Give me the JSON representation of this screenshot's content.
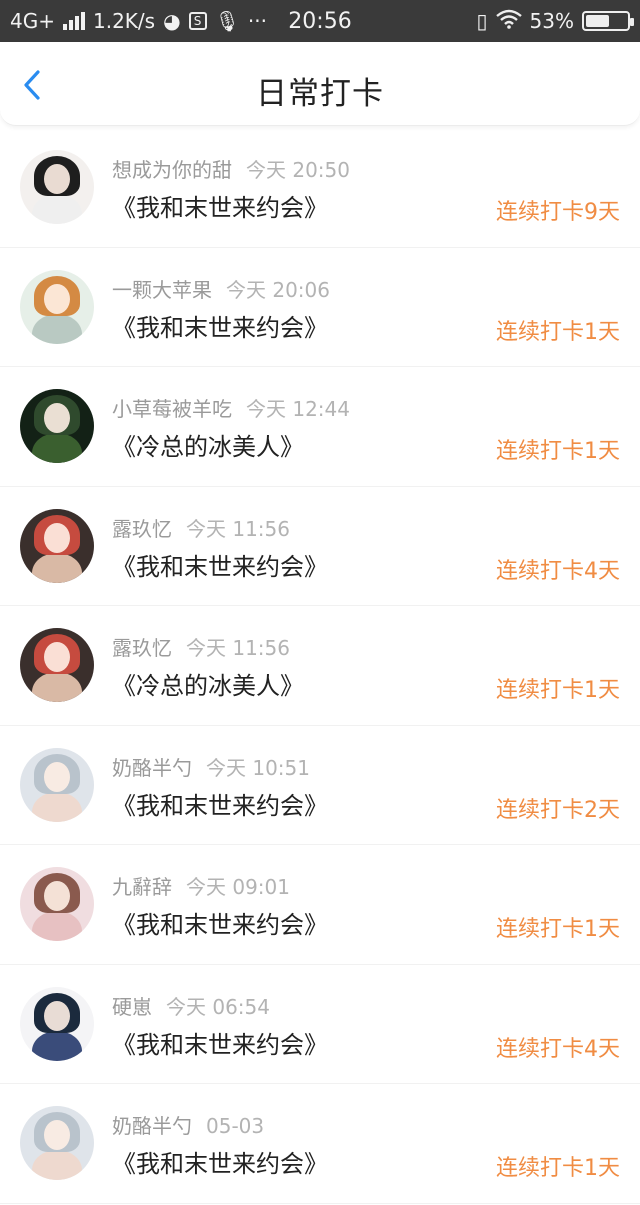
{
  "status_bar": {
    "network": "4G+",
    "speed": "1.2K/s",
    "time": "20:56",
    "battery": "53%",
    "dots": "···",
    "battery_level": 0.53
  },
  "header": {
    "title": "日常打卡",
    "back_icon": "chevron-left-icon",
    "accent_color": "#2a8cf0"
  },
  "items": [
    {
      "name": "想成为你的甜",
      "time": "今天 20:50",
      "book": "《我和末世来约会》",
      "streak": "连续打卡9天",
      "avatar_colors": [
        "#f3f0ee",
        "#1e1e1e",
        "#efefef"
      ]
    },
    {
      "name": "一颗大苹果",
      "time": "今天 20:06",
      "book": "《我和末世来约会》",
      "streak": "连续打卡1天",
      "avatar_colors": [
        "#e6efe8",
        "#d48a43",
        "#b9c9c2"
      ]
    },
    {
      "name": "小草莓被羊吃",
      "time": "今天 12:44",
      "book": "《冷总的冰美人》",
      "streak": "连续打卡1天",
      "avatar_colors": [
        "#132116",
        "#2f4a2d",
        "#3a5f2f"
      ]
    },
    {
      "name": "露玖忆",
      "time": "今天 11:56",
      "book": "《我和末世来约会》",
      "streak": "连续打卡4天",
      "avatar_colors": [
        "#3a2f2c",
        "#c64b3f",
        "#d9b9a5"
      ]
    },
    {
      "name": "露玖忆",
      "time": "今天 11:56",
      "book": "《冷总的冰美人》",
      "streak": "连续打卡1天",
      "avatar_colors": [
        "#3a2f2c",
        "#c64b3f",
        "#d9b9a5"
      ]
    },
    {
      "name": "奶酪半勺",
      "time": "今天 10:51",
      "book": "《我和末世来约会》",
      "streak": "连续打卡2天",
      "avatar_colors": [
        "#dfe4ea",
        "#b9c3cc",
        "#eed9cf"
      ]
    },
    {
      "name": "九辭辞",
      "time": "今天 09:01",
      "book": "《我和末世来约会》",
      "streak": "连续打卡1天",
      "avatar_colors": [
        "#f0dde0",
        "#8a5a4e",
        "#e7c1c2"
      ]
    },
    {
      "name": "硬崽",
      "time": "今天 06:54",
      "book": "《我和末世来约会》",
      "streak": "连续打卡4天",
      "avatar_colors": [
        "#f4f4f6",
        "#1b2a3d",
        "#3a4c7a"
      ]
    },
    {
      "name": "奶酪半勺",
      "time": "05-03",
      "book": "《我和末世来约会》",
      "streak": "连续打卡1天",
      "avatar_colors": [
        "#dfe4ea",
        "#b9c3cc",
        "#eed9cf"
      ]
    }
  ]
}
